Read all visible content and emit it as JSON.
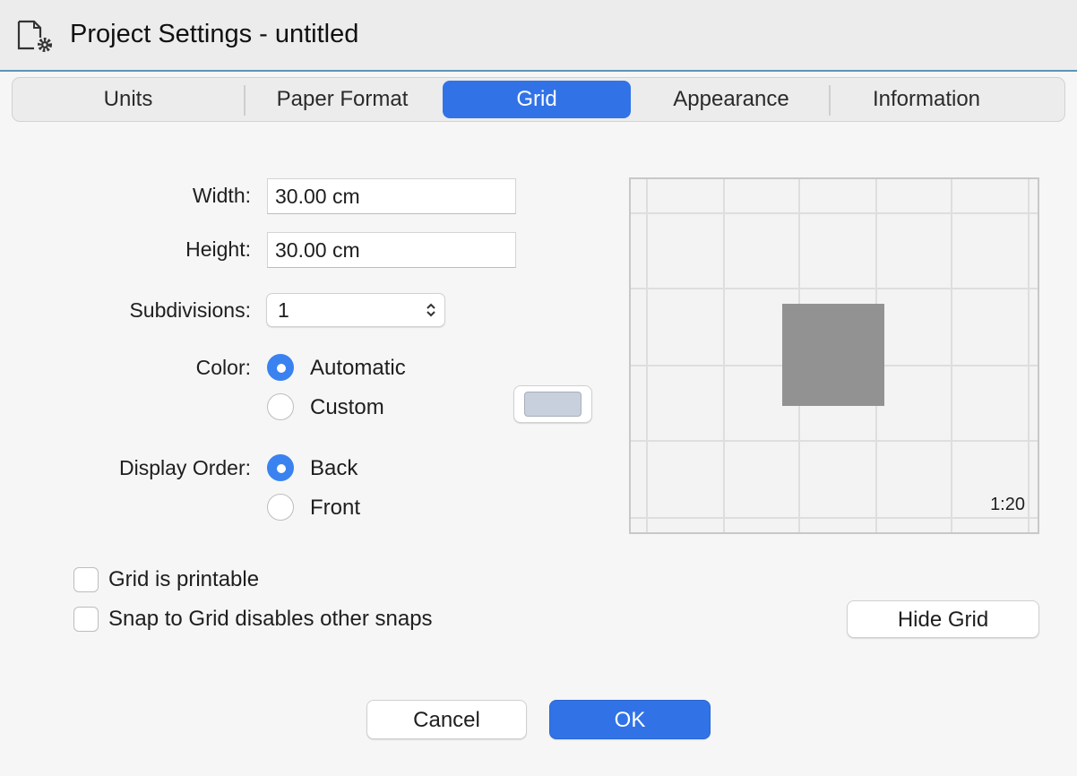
{
  "window": {
    "title": "Project Settings - untitled",
    "icon": "document-gear-icon"
  },
  "tabs": [
    {
      "label": "Units"
    },
    {
      "label": "Paper Format"
    },
    {
      "label": "Grid",
      "selected": true
    },
    {
      "label": "Appearance"
    },
    {
      "label": "Information"
    }
  ],
  "grid": {
    "width_label": "Width:",
    "width_value": "30.00 cm",
    "height_label": "Height:",
    "height_value": "30.00 cm",
    "subdivisions_label": "Subdivisions:",
    "subdivisions_value": "1",
    "color_label": "Color:",
    "color_options": [
      "Automatic",
      "Custom"
    ],
    "color_selected": "Automatic",
    "custom_swatch": "#c9d0dd",
    "order_label": "Display Order:",
    "order_options": [
      "Back",
      "Front"
    ],
    "order_selected": "Back",
    "printable_label": "Grid is printable",
    "printable_checked": false,
    "snap_label": "Snap to Grid disables other snaps",
    "snap_checked": false,
    "preview_scale": "1:20",
    "hide_grid_label": "Hide Grid"
  },
  "footer": {
    "cancel_label": "Cancel",
    "ok_label": "OK"
  },
  "colors": {
    "accent": "#3173e6"
  }
}
